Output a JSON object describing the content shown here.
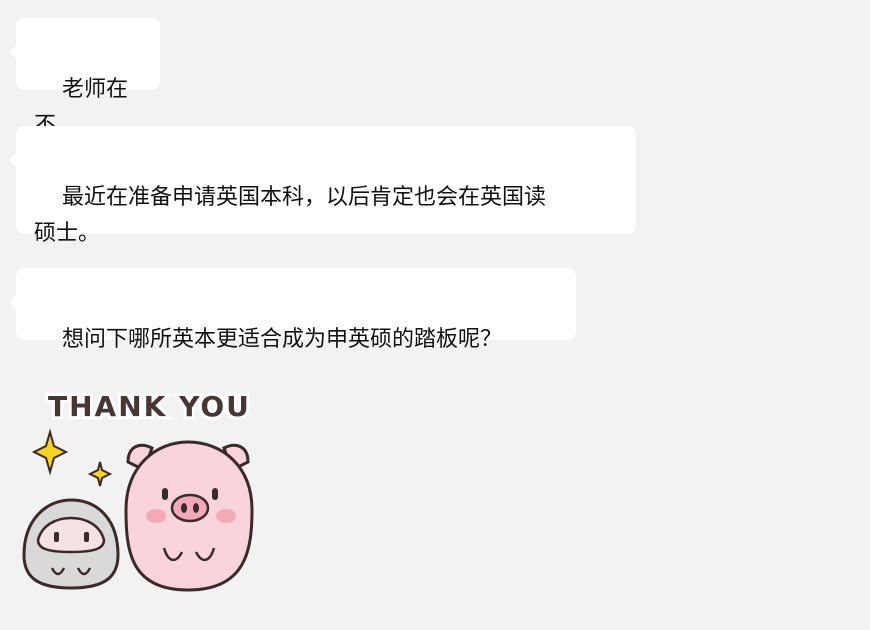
{
  "messages": [
    {
      "text": "老师在不"
    },
    {
      "text": "最近在准备申请英国本科，以后肯定也会在英国读\n硕士。"
    },
    {
      "text": "想问下哪所英本更适合成为申英硕的踏板呢？"
    }
  ],
  "sticker": {
    "caption": "THANK YOU",
    "icon": "pig-sticker-icon"
  },
  "colors": {
    "background": "#f2f2f2",
    "bubble": "#ffffff",
    "pig_pink": "#f9d4dc",
    "gray_friend": "#d9d9d9",
    "sparkle": "#f7d51d"
  }
}
